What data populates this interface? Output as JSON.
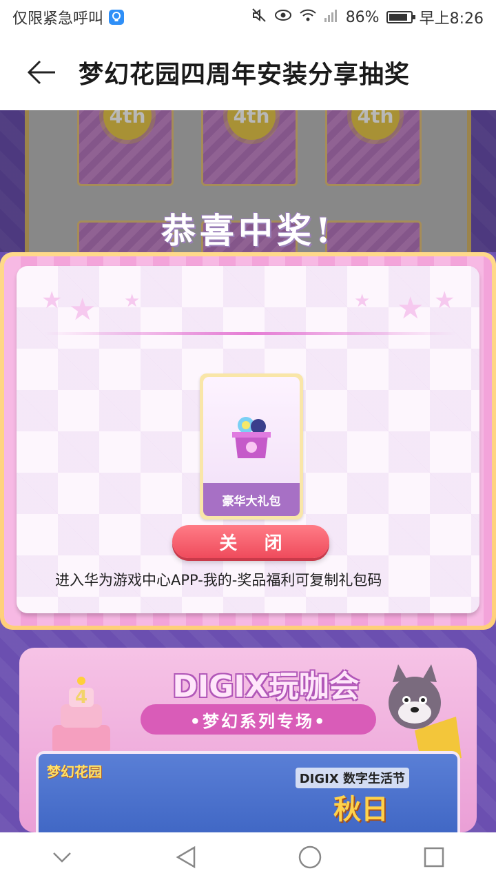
{
  "status_bar": {
    "carrier_text": "仅限紧急呼叫",
    "battery_percent": "86%",
    "time": "早上8:26"
  },
  "header": {
    "title": "梦幻花园四周年安装分享抽奖"
  },
  "background_panel": {
    "congrats_text": "恭喜中奖!",
    "card_badge_text": "4th"
  },
  "modal": {
    "prize_name": "豪华大礼包",
    "close_label": "关 闭",
    "hint": "进入华为游戏中心APP-我的-奖品福利可复制礼包码"
  },
  "banner": {
    "title": "DIGIX玩咖会",
    "subtitle": "•梦幻系列专场•",
    "game_logo": "梦幻花园",
    "digix_label": "DIGIX 数字生活节",
    "autumn_text": "秋日"
  },
  "colors": {
    "accent_close": "#ef4b5c",
    "modal_border": "#ffd98a",
    "prize_band": "#a770c5",
    "background": "#6b4fb0"
  },
  "icons": [
    "bulb-icon",
    "mute-icon",
    "eye-icon",
    "wifi-icon",
    "signal-icon",
    "battery-icon",
    "back-arrow-icon",
    "nav-back-icon",
    "nav-home-icon",
    "nav-recents-icon",
    "nav-collapse-icon"
  ]
}
